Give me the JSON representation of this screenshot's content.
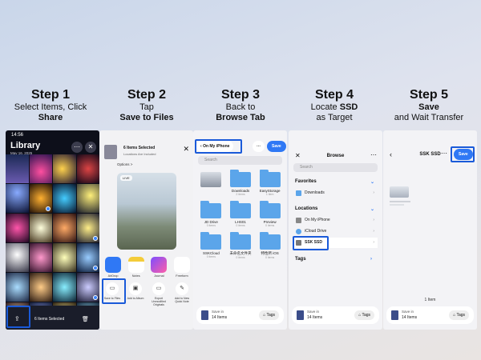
{
  "steps": [
    {
      "title": "Step 1",
      "line1": "Select Items, Click",
      "line2": "Share"
    },
    {
      "title": "Step 2",
      "line1": "Tap",
      "line2": "Save to Files"
    },
    {
      "title": "Step 3",
      "line1": "Back to",
      "line2": "Browse Tab"
    },
    {
      "title": "Step 4",
      "line1_pre": "Locate ",
      "line1_bold": "SSD",
      "line2": "as Target"
    },
    {
      "title": "Step 5",
      "line1": "Save",
      "line2": "and Wait Transfer"
    }
  ],
  "phone1": {
    "time": "14:56",
    "title": "Library",
    "date": "May 16, 2025",
    "selected_label": "6 Items Selected"
  },
  "phone2": {
    "selected": "6 Items Selected",
    "location": "Locations Are Included",
    "options": "Options >",
    "live": "LIVE",
    "apps": [
      "AirDrop",
      "Notes",
      "Journal",
      "Freeform"
    ],
    "actions": [
      "Save to Files",
      "Add to Album",
      "Export Unmodified Originals",
      "Add to New Quick Note"
    ]
  },
  "phone3": {
    "nav_title": "On My iPhone",
    "save": "Save",
    "search": "Search",
    "folders": [
      {
        "name": "",
        "sub": ""
      },
      {
        "name": "Downloads",
        "sub": "2 items"
      },
      {
        "name": "EasyStorage",
        "sub": "1 item"
      },
      {
        "name": "JD Drive",
        "sub": "0 items"
      },
      {
        "name": "LHS01",
        "sub": "0 items"
      },
      {
        "name": "Preview",
        "sub": "0 items"
      },
      {
        "name": "SSKCloud",
        "sub": "0 items"
      },
      {
        "name": "未命名文件夹",
        "sub": "0 items"
      },
      {
        "name": "特性所 iOS",
        "sub": "0 items"
      }
    ],
    "save_in": "Save in",
    "items": "14 Items",
    "tags": "Tags"
  },
  "phone4": {
    "title": "Browse",
    "search": "Search",
    "favorites": "Favorites",
    "downloads": "Downloads",
    "locations": "Locations",
    "loc_items": [
      "On My iPhone",
      "iCloud Drive",
      "SSK SSD"
    ],
    "tags_section": "Tags",
    "save_in": "Save in",
    "items": "14 Items",
    "tags": "Tags"
  },
  "phone5": {
    "title": "SSK SSD",
    "save": "Save",
    "count": "1 Item",
    "save_in": "Save in",
    "items": "14 Items",
    "tags": "Tags"
  },
  "colors": {
    "accent": "#2f78f5",
    "highlight": "#1a5ad9"
  }
}
